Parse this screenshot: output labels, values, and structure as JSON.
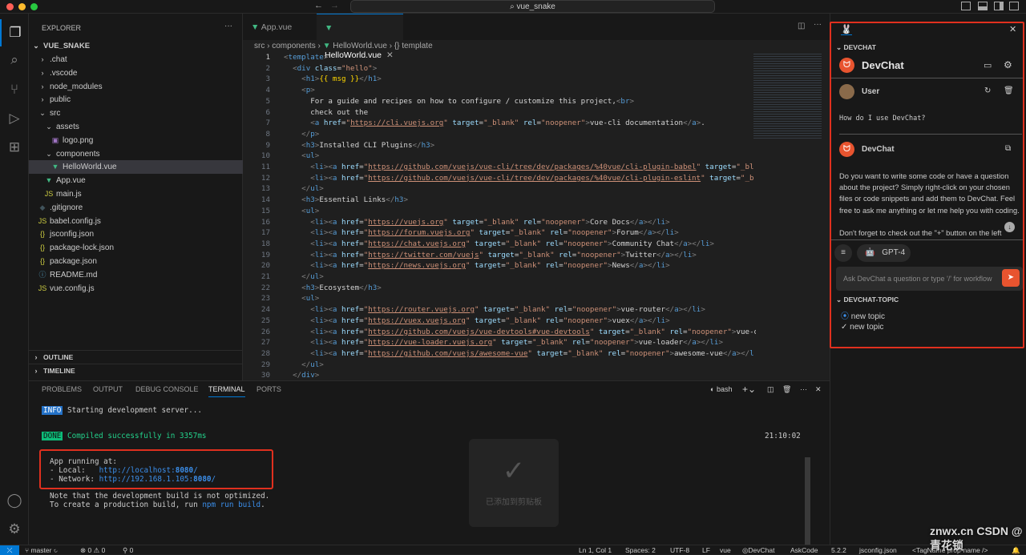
{
  "title_bar": {
    "search_text": "vue_snake"
  },
  "explorer": {
    "title": "EXPLORER",
    "root": "VUE_SNAKE",
    "items": [
      {
        "label": ".chat",
        "depth": 1,
        "kind": "folder"
      },
      {
        "label": ".vscode",
        "depth": 1,
        "kind": "folder"
      },
      {
        "label": "node_modules",
        "depth": 1,
        "kind": "folder"
      },
      {
        "label": "public",
        "depth": 1,
        "kind": "folder"
      },
      {
        "label": "src",
        "depth": 1,
        "kind": "folder-open"
      },
      {
        "label": "assets",
        "depth": 2,
        "kind": "folder-open"
      },
      {
        "label": "logo.png",
        "depth": 3,
        "kind": "image"
      },
      {
        "label": "components",
        "depth": 2,
        "kind": "folder-open"
      },
      {
        "label": "HelloWorld.vue",
        "depth": 3,
        "kind": "vue",
        "selected": true
      },
      {
        "label": "App.vue",
        "depth": 2,
        "kind": "vue"
      },
      {
        "label": "main.js",
        "depth": 2,
        "kind": "js"
      },
      {
        "label": ".gitignore",
        "depth": 1,
        "kind": "git"
      },
      {
        "label": "babel.config.js",
        "depth": 1,
        "kind": "js"
      },
      {
        "label": "jsconfig.json",
        "depth": 1,
        "kind": "json"
      },
      {
        "label": "package-lock.json",
        "depth": 1,
        "kind": "json"
      },
      {
        "label": "package.json",
        "depth": 1,
        "kind": "json"
      },
      {
        "label": "README.md",
        "depth": 1,
        "kind": "md"
      },
      {
        "label": "vue.config.js",
        "depth": 1,
        "kind": "js"
      }
    ],
    "outline": "OUTLINE",
    "timeline": "TIMELINE"
  },
  "editor": {
    "tabs": [
      {
        "label": "App.vue",
        "active": false
      },
      {
        "label": "HelloWorld.vue",
        "active": true
      }
    ],
    "breadcrumb": [
      "src",
      "components",
      "HelloWorld.vue",
      "{} template"
    ],
    "lines": [
      "<template>",
      "  <div class=\"hello\">",
      "    <h1>{{ msg }}</h1>",
      "    <p>",
      "      For a guide and recipes on how to configure / customize this project,<br>",
      "      check out the",
      "      <a href=\"https://cli.vuejs.org\" target=\"_blank\" rel=\"noopener\">vue-cli documentation</a>.",
      "    </p>",
      "    <h3>Installed CLI Plugins</h3>",
      "    <ul>",
      "      <li><a href=\"https://github.com/vuejs/vue-cli/tree/dev/packages/%40vue/cli-plugin-babel\" target=\"_bl",
      "      <li><a href=\"https://github.com/vuejs/vue-cli/tree/dev/packages/%40vue/cli-plugin-eslint\" target=\"_b",
      "    </ul>",
      "    <h3>Essential Links</h3>",
      "    <ul>",
      "      <li><a href=\"https://vuejs.org\" target=\"_blank\" rel=\"noopener\">Core Docs</a></li>",
      "      <li><a href=\"https://forum.vuejs.org\" target=\"_blank\" rel=\"noopener\">Forum</a></li>",
      "      <li><a href=\"https://chat.vuejs.org\" target=\"_blank\" rel=\"noopener\">Community Chat</a></li>",
      "      <li><a href=\"https://twitter.com/vuejs\" target=\"_blank\" rel=\"noopener\">Twitter</a></li>",
      "      <li><a href=\"https://news.vuejs.org\" target=\"_blank\" rel=\"noopener\">News</a></li>",
      "    </ul>",
      "    <h3>Ecosystem</h3>",
      "    <ul>",
      "      <li><a href=\"https://router.vuejs.org\" target=\"_blank\" rel=\"noopener\">vue-router</a></li>",
      "      <li><a href=\"https://vuex.vuejs.org\" target=\"_blank\" rel=\"noopener\">vuex</a></li>",
      "      <li><a href=\"https://github.com/vuejs/vue-devtools#vue-devtools\" target=\"_blank\" rel=\"noopener\">vue-d",
      "      <li><a href=\"https://vue-loader.vuejs.org\" target=\"_blank\" rel=\"noopener\">vue-loader</a></li>",
      "      <li><a href=\"https://github.com/vuejs/awesome-vue\" target=\"_blank\" rel=\"noopener\">awesome-vue</a></l",
      "    </ul>",
      "  </div>"
    ]
  },
  "panel": {
    "tabs": [
      "PROBLEMS",
      "OUTPUT",
      "DEBUG CONSOLE",
      "TERMINAL",
      "PORTS"
    ],
    "active_tab": "TERMINAL",
    "shell": "bash",
    "terminal": {
      "info_badge": "INFO",
      "info_text": "Starting development server...",
      "done_badge": "DONE",
      "done_text": "Compiled successfully in 3357ms",
      "time": "21:10:02",
      "app_running": "App running at:",
      "local_label": "- Local:   ",
      "local_url_prefix": "http://localhost:",
      "local_port": "8080",
      "network_label": "- Network: ",
      "network_url_prefix": "http://192.168.1.105:",
      "network_port": "8080",
      "note1": "Note that the development build is not optimized.",
      "note2_prefix": "To create a production build, run ",
      "note2_cmd": "npm run build",
      "note2_suffix": ".",
      "toast": "已添加到剪贴板"
    }
  },
  "devchat": {
    "section": "DEVCHAT",
    "title": "DevChat",
    "user_name": "User",
    "user_message": "How do I use DevChat?",
    "bot_name": "DevChat",
    "bot_message": "Do you want to write some code or have a question about the project? Simply right-click on your chosen files or code snippets and add them to DevChat. Feel free to ask me anything or let me help you with coding.",
    "bot_message_cut": "Don't forget to check out the \"+\" button on the left",
    "model": "GPT-4",
    "input_placeholder": "Ask DevChat a question or type '/' for workflow",
    "topic_section": "DEVCHAT-TOPIC",
    "topics": [
      "new topic",
      "new topic"
    ],
    "accent": "#e8542f"
  },
  "status_bar": {
    "branch": "master",
    "errors": "0",
    "warnings": "0",
    "ports": "0",
    "position": "Ln 1, Col 1",
    "spaces": "Spaces: 2",
    "encoding": "UTF-8",
    "eol": "LF",
    "language": "vue",
    "devchat": "DevChat",
    "askcode": "AskCode",
    "version": "5.2.2",
    "config": "jsconfig.json",
    "tagname": "<TagName prop-name />"
  },
  "watermark": "znwx.cn  CSDN @青花锁"
}
